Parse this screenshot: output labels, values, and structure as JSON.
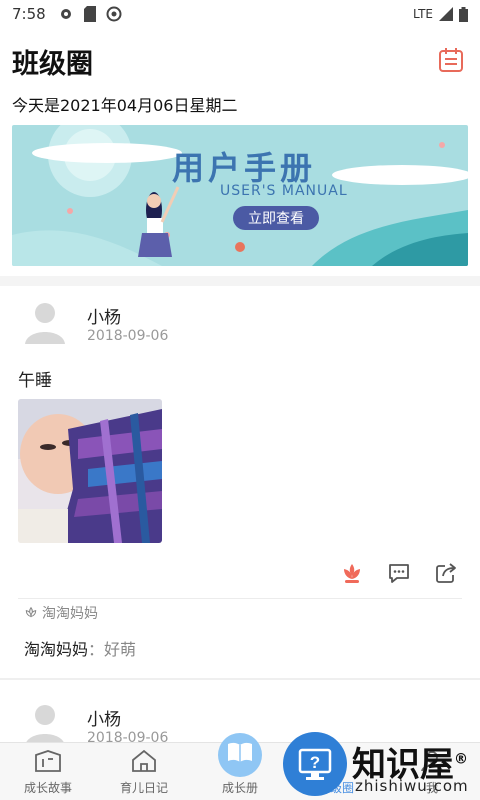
{
  "status_bar": {
    "time": "7:58",
    "network": "LTE"
  },
  "header": {
    "title": "班级圈",
    "date_text": "今天是2021年04月06日星期二"
  },
  "banner": {
    "title": "用户手册",
    "subtitle": "USER'S MANUAL",
    "button_label": "立即查看"
  },
  "posts": [
    {
      "author": "小杨",
      "date": "2018-09-06",
      "text": "午睡",
      "likes": "淘淘妈妈",
      "comment": {
        "author": "淘淘妈妈",
        "sep": "：",
        "text": "好萌"
      }
    },
    {
      "author": "小杨",
      "date": "2018-09-06"
    }
  ],
  "bottom_nav": [
    {
      "label": "成长故事",
      "icon": "story-icon"
    },
    {
      "label": "育儿日记",
      "icon": "home-icon"
    },
    {
      "label": "成长册",
      "icon": "book-icon"
    },
    {
      "label": "班级圈",
      "icon": "circle-icon"
    },
    {
      "label": "我",
      "icon": "user-icon"
    }
  ],
  "watermark": {
    "brand": "知识屋",
    "domain": "zhishiwu.com",
    "registered": "®",
    "badge": "?"
  },
  "colors": {
    "accent": "#4a90e2",
    "like": "#f06a5a",
    "calendar": "#e86a5a",
    "banner_bg": "#a9dde1"
  }
}
